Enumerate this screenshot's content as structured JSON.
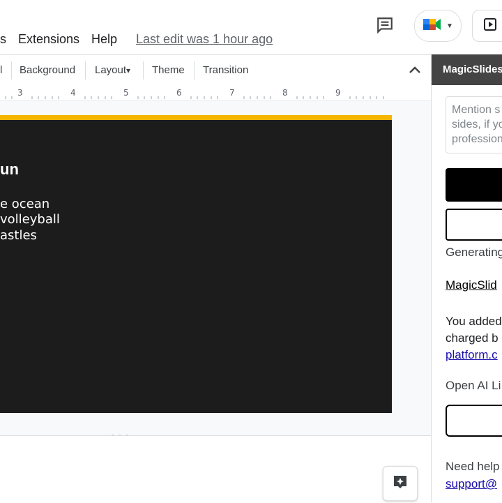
{
  "menu": {
    "items": [
      "s",
      "Extensions",
      "Help"
    ],
    "last_edit": "Last edit was 1 hour ago"
  },
  "toolbar": {
    "items": [
      "l",
      "Background",
      "Layout",
      "Theme",
      "Transition"
    ],
    "layout_caret": "▾",
    "collapse": "⌃"
  },
  "ruler": {
    "numbers": [
      "3",
      "4",
      "5",
      "6",
      "7",
      "8",
      "9"
    ]
  },
  "slide": {
    "title": "un",
    "bullets": [
      "e ocean",
      "volleyball",
      "astles"
    ]
  },
  "panel": {
    "title": "MagicSlides",
    "textarea_placeholder": "Mention s\nsides, if yo\nprofession",
    "generating": "Generating",
    "link1": "MagicSlid",
    "added_line1": "You added",
    "added_line2": "charged b",
    "added_link": "platform.c",
    "openai": "Open AI Li",
    "help": "Need help",
    "support": "support@"
  },
  "colors": {
    "accent": "#f4b400",
    "slide_bg": "#1c1c1c",
    "panel_head": "#444444"
  }
}
